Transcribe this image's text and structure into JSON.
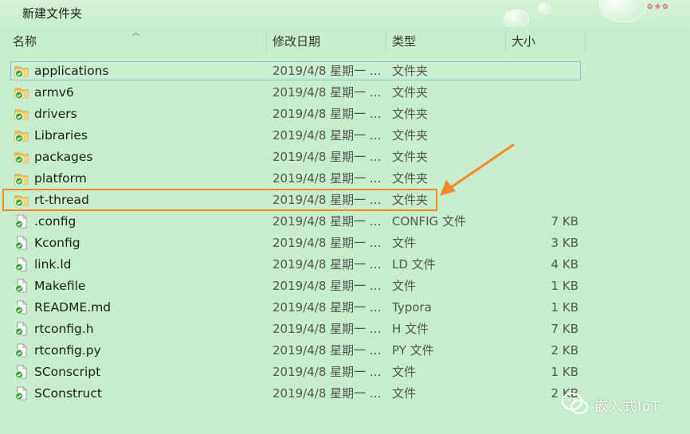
{
  "toolbar": {
    "new_folder_label": "新建文件夹"
  },
  "columns": {
    "name": "名称",
    "date": "修改日期",
    "type": "类型",
    "size": "大小"
  },
  "files": [
    {
      "name": "applications",
      "date": "2019/4/8 星期一 ...",
      "type": "文件夹",
      "size": "",
      "kind": "folder"
    },
    {
      "name": "armv6",
      "date": "2019/4/8 星期一 ...",
      "type": "文件夹",
      "size": "",
      "kind": "folder"
    },
    {
      "name": "drivers",
      "date": "2019/4/8 星期一 ...",
      "type": "文件夹",
      "size": "",
      "kind": "folder"
    },
    {
      "name": "Libraries",
      "date": "2019/4/8 星期一 ...",
      "type": "文件夹",
      "size": "",
      "kind": "folder"
    },
    {
      "name": "packages",
      "date": "2019/4/8 星期一 ...",
      "type": "文件夹",
      "size": "",
      "kind": "folder"
    },
    {
      "name": "platform",
      "date": "2019/4/8 星期一 ...",
      "type": "文件夹",
      "size": "",
      "kind": "folder"
    },
    {
      "name": "rt-thread",
      "date": "2019/4/8 星期一 ...",
      "type": "文件夹",
      "size": "",
      "kind": "folder"
    },
    {
      "name": ".config",
      "date": "2019/4/8 星期一 ...",
      "type": "CONFIG 文件",
      "size": "7 KB",
      "kind": "file"
    },
    {
      "name": "Kconfig",
      "date": "2019/4/8 星期一 ...",
      "type": "文件",
      "size": "3 KB",
      "kind": "file"
    },
    {
      "name": "link.ld",
      "date": "2019/4/8 星期一 ...",
      "type": "LD 文件",
      "size": "4 KB",
      "kind": "file"
    },
    {
      "name": "Makefile",
      "date": "2019/4/8 星期一 ...",
      "type": "文件",
      "size": "1 KB",
      "kind": "file"
    },
    {
      "name": "README.md",
      "date": "2019/4/8 星期一 ...",
      "type": "Typora",
      "size": "1 KB",
      "kind": "file"
    },
    {
      "name": "rtconfig.h",
      "date": "2019/4/8 星期一 ...",
      "type": "H 文件",
      "size": "7 KB",
      "kind": "file"
    },
    {
      "name": "rtconfig.py",
      "date": "2019/4/8 星期一 ...",
      "type": "PY 文件",
      "size": "2 KB",
      "kind": "file"
    },
    {
      "name": "SConscript",
      "date": "2019/4/8 星期一 ...",
      "type": "文件",
      "size": "1 KB",
      "kind": "file"
    },
    {
      "name": "SConstruct",
      "date": "2019/4/8 星期一 ...",
      "type": "文件",
      "size": "2 KB",
      "kind": "file"
    }
  ],
  "selected_index": 0,
  "highlighted_index": 6,
  "watermark": {
    "text": "嵌入式IoT"
  },
  "colors": {
    "background": "#c7edcc",
    "highlight": "#f08a2c",
    "selection_border": "#8fb9d8",
    "folder": "#f3c35a",
    "check": "#3aa63a"
  },
  "icons": {
    "folder": "folder-icon",
    "file": "document-icon",
    "sync_badge": "green-check-badge-icon"
  }
}
